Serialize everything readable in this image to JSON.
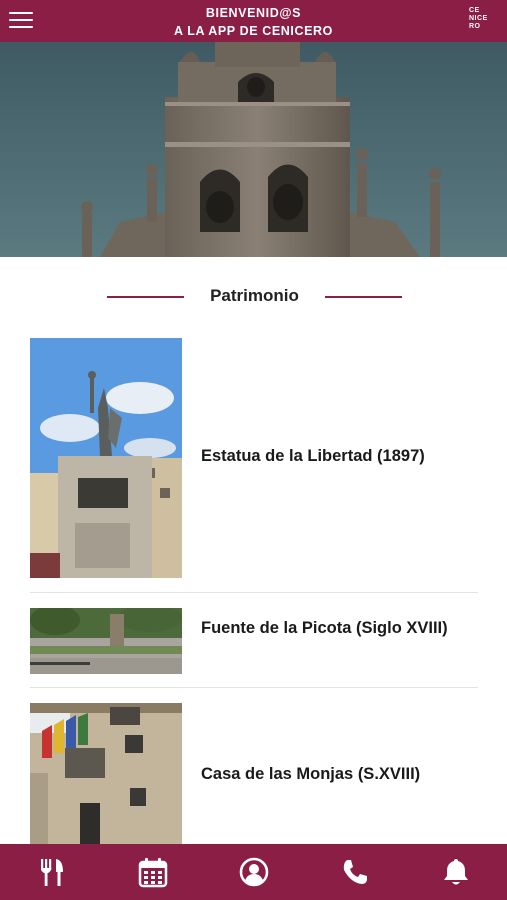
{
  "header": {
    "title_line1": "BIENVENID@S",
    "title_line2": "A LA APP DE CENICERO",
    "logo_line1": "CE",
    "logo_line2": "NICE",
    "logo_line3": "RO",
    "menu_icon": "hamburger-menu-icon"
  },
  "section": {
    "title": "Patrimonio"
  },
  "items": [
    {
      "label": "Estatua de la Libertad (1897)"
    },
    {
      "label": "Fuente de la Picota (Siglo XVIII)"
    },
    {
      "label": "Casa de las Monjas (S.XVIII)"
    }
  ],
  "tabbar": {
    "icons": [
      "fork-knife-icon",
      "calendar-icon",
      "user-circle-icon",
      "phone-icon",
      "bell-icon"
    ]
  },
  "colors": {
    "brand": "#8b1e45",
    "background": "#ffffff",
    "text": "#1a1a1a"
  }
}
